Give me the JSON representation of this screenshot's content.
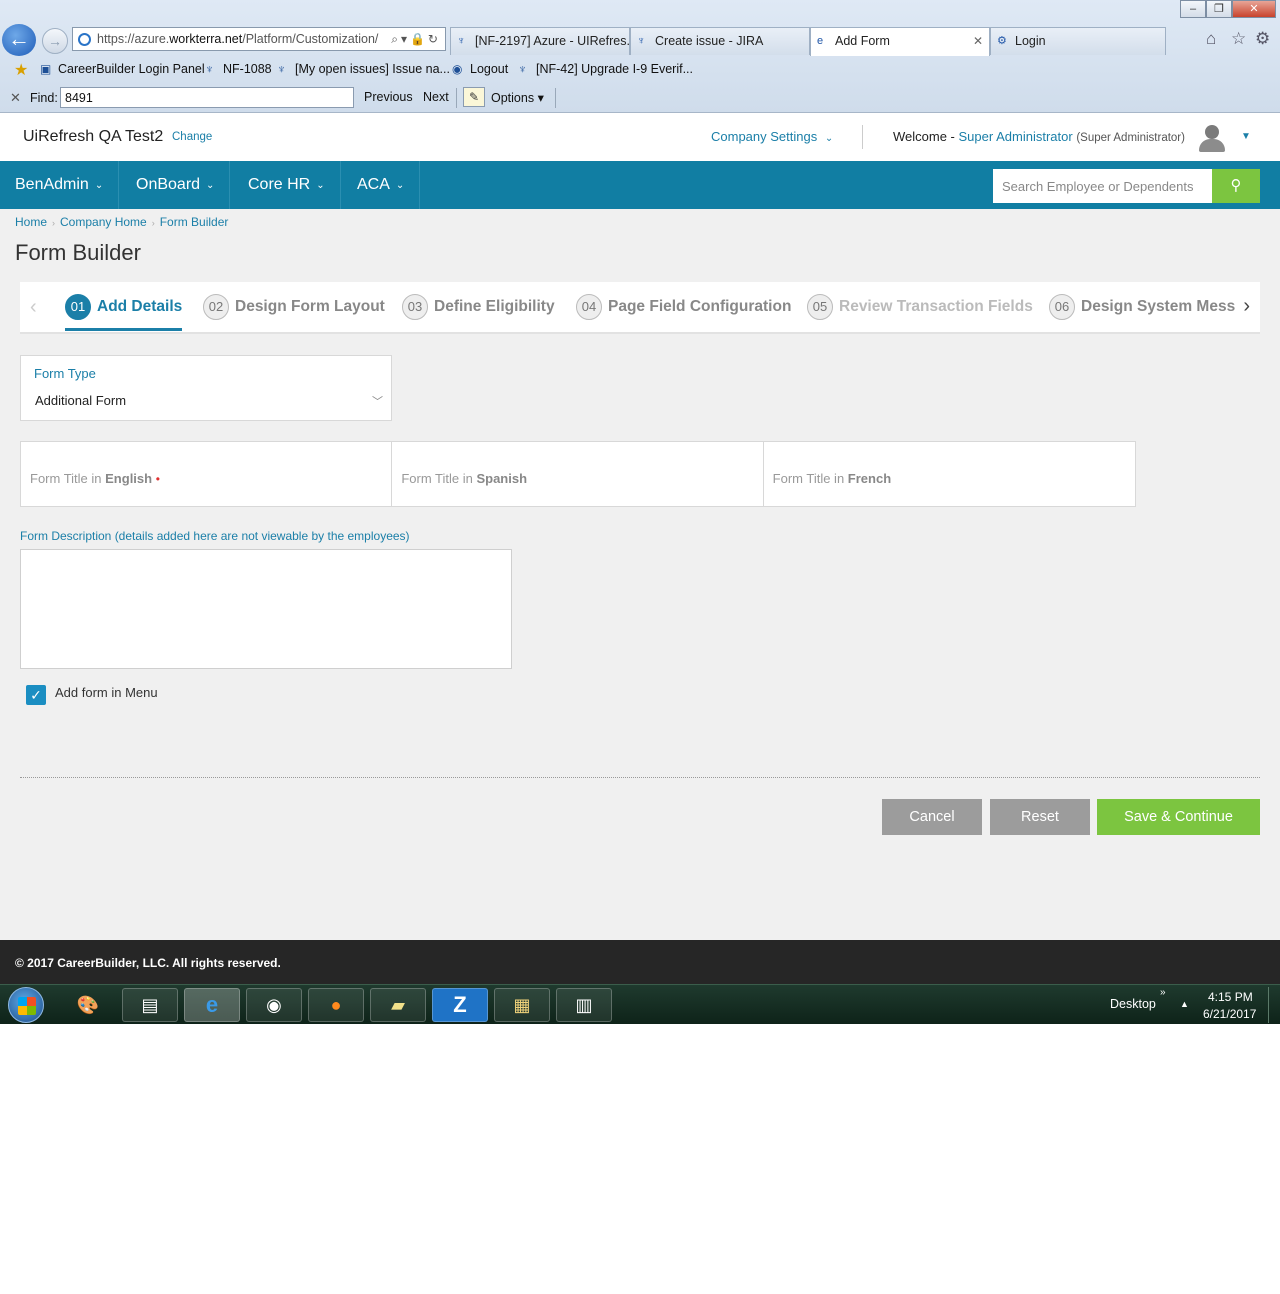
{
  "browser": {
    "url_prefix": "https://azure.",
    "url_domain": "workterra.net",
    "url_path": "/Platform/Customization/",
    "tabs": [
      {
        "label": "[NF-2197] Azure - UIRefres..."
      },
      {
        "label": "Create issue - JIRA"
      },
      {
        "label": "Add Form"
      },
      {
        "label": "Login"
      }
    ],
    "favorites": [
      {
        "label": "CareerBuilder Login Panel"
      },
      {
        "label": "NF-1088"
      },
      {
        "label": "[My open issues] Issue na..."
      },
      {
        "label": "Logout"
      },
      {
        "label": "[NF-42] Upgrade I-9 Everif..."
      }
    ],
    "find": {
      "label": "Find:",
      "value": "8491",
      "previous": "Previous",
      "next": "Next",
      "options": "Options"
    }
  },
  "header": {
    "company_name": "UiRefresh QA Test2",
    "change": "Change",
    "company_settings": "Company Settings",
    "welcome": "Welcome -",
    "user_name": "Super Administrator",
    "user_role": "(Super Administrator)"
  },
  "nav": {
    "items": [
      {
        "label": "BenAdmin"
      },
      {
        "label": "OnBoard"
      },
      {
        "label": "Core HR"
      },
      {
        "label": "ACA"
      }
    ],
    "search_placeholder": "Search Employee or Dependents"
  },
  "breadcrumb": [
    "Home",
    "Company Home",
    "Form Builder"
  ],
  "page_title": "Form Builder",
  "steps": [
    {
      "num": "01",
      "label": "Add Details",
      "state": "active"
    },
    {
      "num": "02",
      "label": "Design Form Layout",
      "state": "normal"
    },
    {
      "num": "03",
      "label": "Define Eligibility",
      "state": "normal"
    },
    {
      "num": "04",
      "label": "Page Field Configuration",
      "state": "normal"
    },
    {
      "num": "05",
      "label": "Review Transaction Fields",
      "state": "disabled"
    },
    {
      "num": "06",
      "label": "Design System Mess",
      "state": "normal"
    }
  ],
  "form": {
    "form_type_label": "Form Type",
    "form_type_value": "Additional Form",
    "title_prefix": "Form Title in",
    "title_english": "English",
    "title_spanish": "Spanish",
    "title_french": "French",
    "description_label": "Form Description (details added here are not viewable by the employees)",
    "add_in_menu_label": "Add form in Menu",
    "add_in_menu_checked": true
  },
  "buttons": {
    "cancel": "Cancel",
    "reset": "Reset",
    "save_continue": "Save & Continue"
  },
  "footer": {
    "copyright": "© 2017 CareerBuilder, LLC. All rights reserved."
  },
  "taskbar": {
    "desktop": "Desktop",
    "time": "4:15 PM",
    "date": "6/21/2017"
  },
  "colors": {
    "brand": "#117ea3",
    "accent_green": "#7cc540",
    "link": "#1b7fa8"
  }
}
